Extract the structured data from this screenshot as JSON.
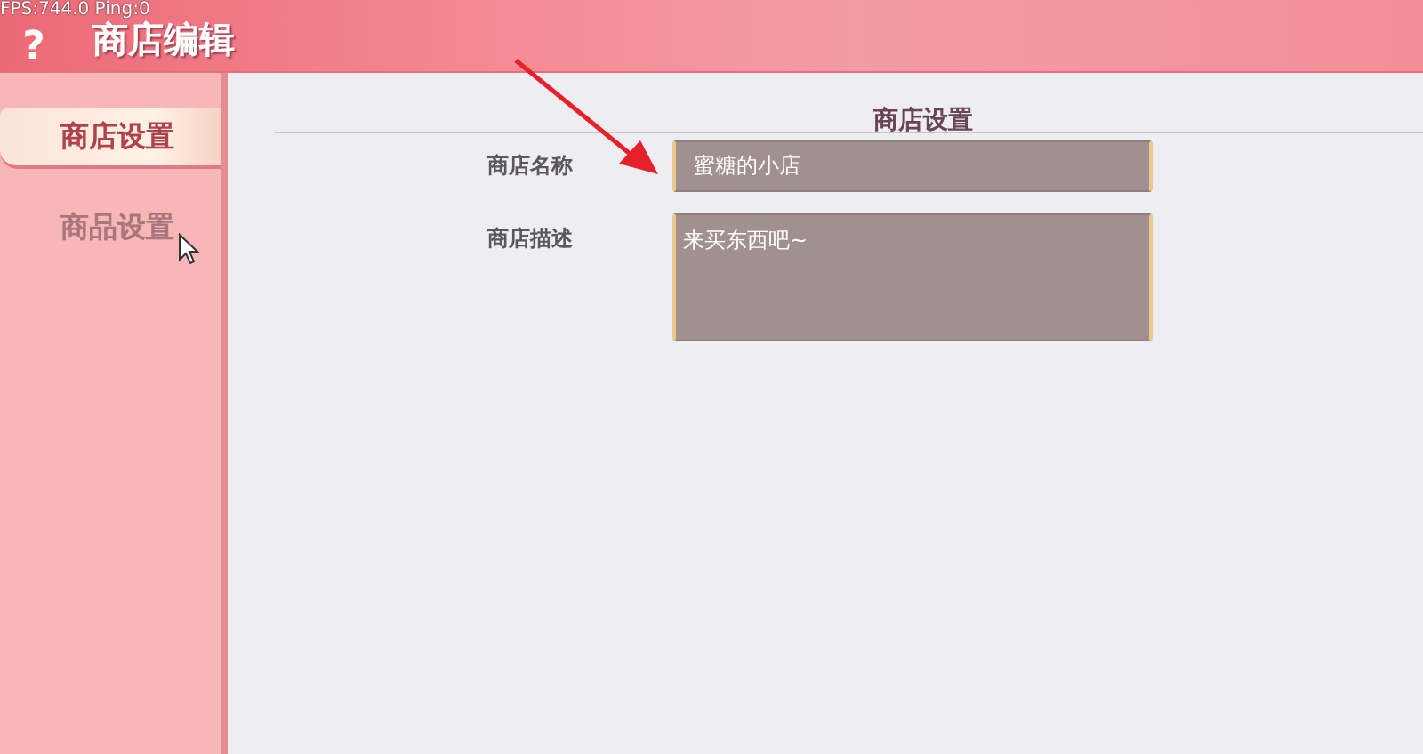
{
  "overlay": {
    "fps": "FPS:744.0  Ping:0"
  },
  "header": {
    "help": "?",
    "title": "商店编辑"
  },
  "sidebar": {
    "items": [
      {
        "label": "商店设置",
        "selected": true
      },
      {
        "label": "商品设置",
        "selected": false
      }
    ]
  },
  "panel": {
    "title": "商店设置",
    "fields": [
      {
        "kind": "input",
        "label": "商店名称",
        "value": "蜜糖的小店"
      },
      {
        "kind": "textarea",
        "label": "商店描述",
        "value": "来买东西吧~"
      }
    ]
  }
}
